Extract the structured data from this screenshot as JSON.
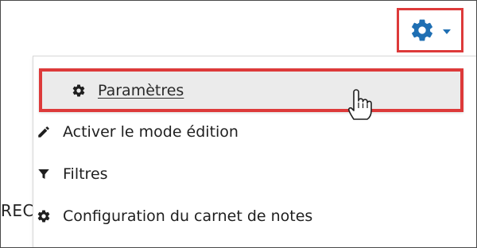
{
  "background_text": "REC",
  "settings_menu": {
    "toggle_icon": "gear-icon",
    "accent_color": "#1f6fb3",
    "highlight_color": "#dd3a3a",
    "items": [
      {
        "label": "Paramètres",
        "icon": "gear-icon"
      },
      {
        "label": "Activer le mode édition",
        "icon": "pencil-icon"
      },
      {
        "label": "Filtres",
        "icon": "filter-icon"
      },
      {
        "label": "Configuration du carnet de notes",
        "icon": "gear-icon"
      }
    ]
  }
}
